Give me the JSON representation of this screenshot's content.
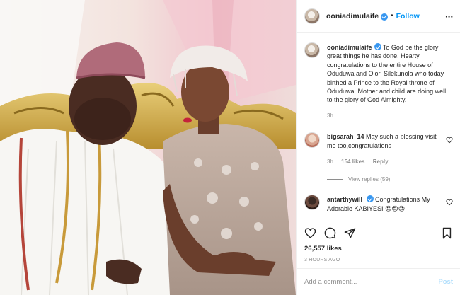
{
  "post": {
    "author": "ooniadimulaife",
    "follow_label": "Follow",
    "separator": "•",
    "more_label": "···",
    "caption_author": "ooniadimulaife",
    "caption_text": "To God be the glory great things he has done. Hearty congratulations to the entire House of Oduduwa and Olori Silekunola who today birthed a Prince to the Royal throne of Oduduwa. Mother and child are doing well to the glory of God Almighty.",
    "caption_age": "3h",
    "likes": "26,557 likes",
    "posted": "3 HOURS AGO"
  },
  "comments": [
    {
      "user": "bigsarah_14",
      "text": "May such a blessing visit me too,congratulations",
      "age": "3h",
      "likes": "154 likes",
      "reply_label": "Reply",
      "view_replies": "View replies (59)"
    },
    {
      "user": "antarthywill",
      "text": "Congratulations My Adorable KABIYESI 😍😍😍"
    }
  ],
  "add_comment": {
    "placeholder": "Add a comment...",
    "post_label": "Post"
  },
  "icons": {
    "verified": "verified-badge-icon",
    "like": "heart-icon",
    "comment": "comment-bubble-icon",
    "share": "paper-plane-icon",
    "save": "bookmark-icon"
  },
  "colors": {
    "accent": "#0095f6",
    "verified": "#3897f0",
    "muted": "#8e8e8e",
    "post_disabled": "#b2dffc"
  }
}
